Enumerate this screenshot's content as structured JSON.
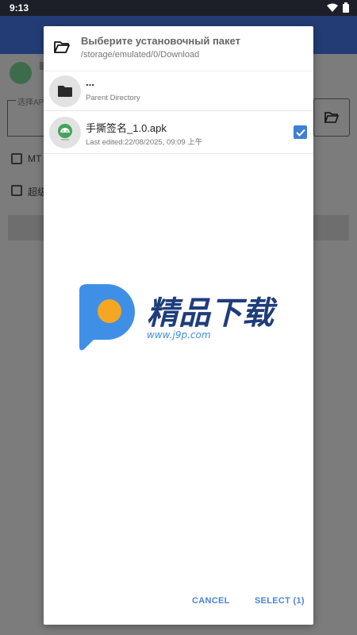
{
  "status_bar": {
    "time": "9:13"
  },
  "background_app": {
    "input_label": "选择AP",
    "option_1_label": "MT",
    "option_2_label": "超级"
  },
  "dialog": {
    "title": "Выберите установочный пакет",
    "path": "/storage/emulated/0/Download",
    "items": [
      {
        "name": "...",
        "subtitle": "Parent Directory",
        "icon": "folder-icon"
      },
      {
        "name": "手撕签名_1.0.apk",
        "subtitle": "Last edited:22/08/2025, 09:09 上午",
        "icon": "android-apk-icon",
        "selected": true
      }
    ],
    "cancel_label": "CANCEL",
    "select_label": "SELECT (1)"
  },
  "watermark": {
    "brand": "精品下载",
    "url": "www.j9p.com"
  },
  "colors": {
    "accent": "#4a86d6",
    "checkbox": "#3f7fd6",
    "header_bg": "#233c75",
    "scrim": "#7c7c7c"
  }
}
